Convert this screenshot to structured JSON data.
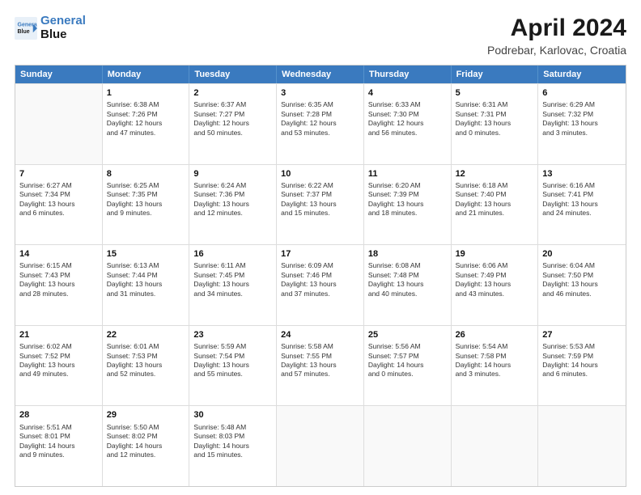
{
  "logo": {
    "line1": "General",
    "line2": "Blue"
  },
  "title": "April 2024",
  "subtitle": "Podrebar, Karlovac, Croatia",
  "calendar": {
    "headers": [
      "Sunday",
      "Monday",
      "Tuesday",
      "Wednesday",
      "Thursday",
      "Friday",
      "Saturday"
    ],
    "rows": [
      [
        {
          "day": "",
          "info": ""
        },
        {
          "day": "1",
          "info": "Sunrise: 6:38 AM\nSunset: 7:26 PM\nDaylight: 12 hours\nand 47 minutes."
        },
        {
          "day": "2",
          "info": "Sunrise: 6:37 AM\nSunset: 7:27 PM\nDaylight: 12 hours\nand 50 minutes."
        },
        {
          "day": "3",
          "info": "Sunrise: 6:35 AM\nSunset: 7:28 PM\nDaylight: 12 hours\nand 53 minutes."
        },
        {
          "day": "4",
          "info": "Sunrise: 6:33 AM\nSunset: 7:30 PM\nDaylight: 12 hours\nand 56 minutes."
        },
        {
          "day": "5",
          "info": "Sunrise: 6:31 AM\nSunset: 7:31 PM\nDaylight: 13 hours\nand 0 minutes."
        },
        {
          "day": "6",
          "info": "Sunrise: 6:29 AM\nSunset: 7:32 PM\nDaylight: 13 hours\nand 3 minutes."
        }
      ],
      [
        {
          "day": "7",
          "info": "Sunrise: 6:27 AM\nSunset: 7:34 PM\nDaylight: 13 hours\nand 6 minutes."
        },
        {
          "day": "8",
          "info": "Sunrise: 6:25 AM\nSunset: 7:35 PM\nDaylight: 13 hours\nand 9 minutes."
        },
        {
          "day": "9",
          "info": "Sunrise: 6:24 AM\nSunset: 7:36 PM\nDaylight: 13 hours\nand 12 minutes."
        },
        {
          "day": "10",
          "info": "Sunrise: 6:22 AM\nSunset: 7:37 PM\nDaylight: 13 hours\nand 15 minutes."
        },
        {
          "day": "11",
          "info": "Sunrise: 6:20 AM\nSunset: 7:39 PM\nDaylight: 13 hours\nand 18 minutes."
        },
        {
          "day": "12",
          "info": "Sunrise: 6:18 AM\nSunset: 7:40 PM\nDaylight: 13 hours\nand 21 minutes."
        },
        {
          "day": "13",
          "info": "Sunrise: 6:16 AM\nSunset: 7:41 PM\nDaylight: 13 hours\nand 24 minutes."
        }
      ],
      [
        {
          "day": "14",
          "info": "Sunrise: 6:15 AM\nSunset: 7:43 PM\nDaylight: 13 hours\nand 28 minutes."
        },
        {
          "day": "15",
          "info": "Sunrise: 6:13 AM\nSunset: 7:44 PM\nDaylight: 13 hours\nand 31 minutes."
        },
        {
          "day": "16",
          "info": "Sunrise: 6:11 AM\nSunset: 7:45 PM\nDaylight: 13 hours\nand 34 minutes."
        },
        {
          "day": "17",
          "info": "Sunrise: 6:09 AM\nSunset: 7:46 PM\nDaylight: 13 hours\nand 37 minutes."
        },
        {
          "day": "18",
          "info": "Sunrise: 6:08 AM\nSunset: 7:48 PM\nDaylight: 13 hours\nand 40 minutes."
        },
        {
          "day": "19",
          "info": "Sunrise: 6:06 AM\nSunset: 7:49 PM\nDaylight: 13 hours\nand 43 minutes."
        },
        {
          "day": "20",
          "info": "Sunrise: 6:04 AM\nSunset: 7:50 PM\nDaylight: 13 hours\nand 46 minutes."
        }
      ],
      [
        {
          "day": "21",
          "info": "Sunrise: 6:02 AM\nSunset: 7:52 PM\nDaylight: 13 hours\nand 49 minutes."
        },
        {
          "day": "22",
          "info": "Sunrise: 6:01 AM\nSunset: 7:53 PM\nDaylight: 13 hours\nand 52 minutes."
        },
        {
          "day": "23",
          "info": "Sunrise: 5:59 AM\nSunset: 7:54 PM\nDaylight: 13 hours\nand 55 minutes."
        },
        {
          "day": "24",
          "info": "Sunrise: 5:58 AM\nSunset: 7:55 PM\nDaylight: 13 hours\nand 57 minutes."
        },
        {
          "day": "25",
          "info": "Sunrise: 5:56 AM\nSunset: 7:57 PM\nDaylight: 14 hours\nand 0 minutes."
        },
        {
          "day": "26",
          "info": "Sunrise: 5:54 AM\nSunset: 7:58 PM\nDaylight: 14 hours\nand 3 minutes."
        },
        {
          "day": "27",
          "info": "Sunrise: 5:53 AM\nSunset: 7:59 PM\nDaylight: 14 hours\nand 6 minutes."
        }
      ],
      [
        {
          "day": "28",
          "info": "Sunrise: 5:51 AM\nSunset: 8:01 PM\nDaylight: 14 hours\nand 9 minutes."
        },
        {
          "day": "29",
          "info": "Sunrise: 5:50 AM\nSunset: 8:02 PM\nDaylight: 14 hours\nand 12 minutes."
        },
        {
          "day": "30",
          "info": "Sunrise: 5:48 AM\nSunset: 8:03 PM\nDaylight: 14 hours\nand 15 minutes."
        },
        {
          "day": "",
          "info": ""
        },
        {
          "day": "",
          "info": ""
        },
        {
          "day": "",
          "info": ""
        },
        {
          "day": "",
          "info": ""
        }
      ]
    ]
  }
}
